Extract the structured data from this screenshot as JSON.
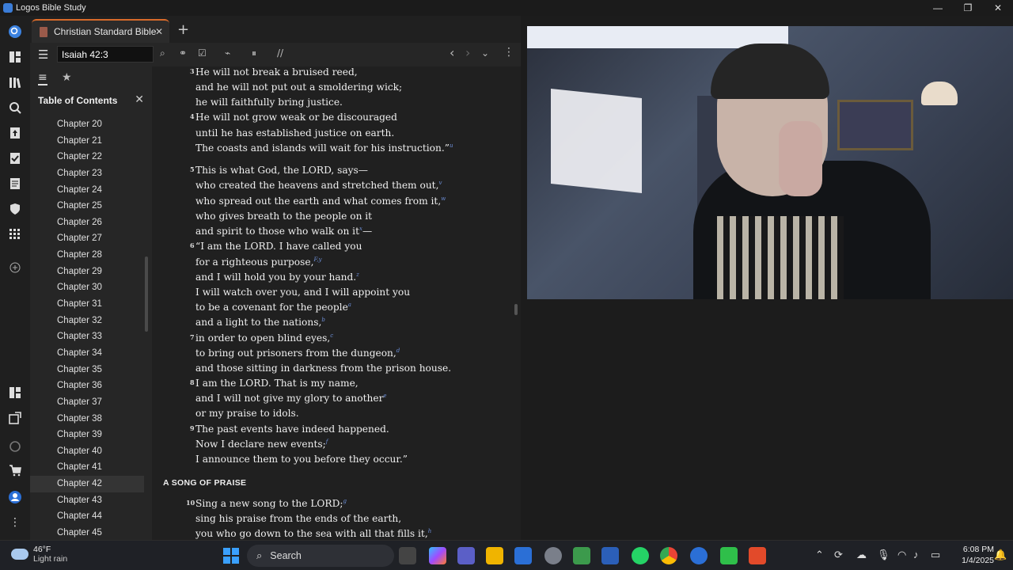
{
  "window": {
    "title": "Logos Bible Study",
    "minimize": "—",
    "restore": "❐",
    "close": "✕"
  },
  "tab": {
    "title": "Christian Standard Bible",
    "close": "✕",
    "new_tab": "+"
  },
  "toolbar": {
    "menu": "☰",
    "reference": "Isaiah 42:3",
    "search_icon": "⌕",
    "visual_filter_icon": "⚭",
    "highlight_icon": "☑",
    "inline_icon": "⌁",
    "layout_icon": "⏸",
    "parallel_icon": "//",
    "back": "‹",
    "forward": "›",
    "history": "⌄",
    "more": "⋮"
  },
  "sidebar": {
    "tab_contents_icon": "≡",
    "tab_favorites_icon": "★",
    "title": "Table of Contents",
    "close": "✕",
    "chapters": [
      "Chapter 20",
      "Chapter 21",
      "Chapter 22",
      "Chapter 23",
      "Chapter 24",
      "Chapter 25",
      "Chapter 26",
      "Chapter 27",
      "Chapter 28",
      "Chapter 29",
      "Chapter 30",
      "Chapter 31",
      "Chapter 32",
      "Chapter 33",
      "Chapter 34",
      "Chapter 35",
      "Chapter 36",
      "Chapter 37",
      "Chapter 38",
      "Chapter 39",
      "Chapter 40",
      "Chapter 41",
      "Chapter 42",
      "Chapter 43",
      "Chapter 44",
      "Chapter 45"
    ],
    "selected": "Chapter 42"
  },
  "reader": {
    "lines": [
      {
        "verse": "3",
        "text": "He will not break a bruised reed,",
        "fn": ""
      },
      {
        "verse": "",
        "text": "and he will not put out a smoldering wick;",
        "fn": ""
      },
      {
        "verse": "",
        "text": "he will faithfully bring justice.",
        "fn": ""
      },
      {
        "verse": "4",
        "text": "He will not grow weak or be discouraged",
        "fn": ""
      },
      {
        "verse": "",
        "text": "until he has established justice on earth.",
        "fn": ""
      },
      {
        "verse": "",
        "text": "The coasts and islands will wait for his instruction.”",
        "fn": "u"
      },
      {
        "verse": "5",
        "text": "This is what God, the LORD, says—",
        "fn": ""
      },
      {
        "verse": "",
        "text": "who created the heavens and stretched them out,",
        "fn": "v"
      },
      {
        "verse": "",
        "text": "who spread out the earth and what comes from it,",
        "fn": "w"
      },
      {
        "verse": "",
        "text": "who gives breath to the people on it",
        "fn": ""
      },
      {
        "verse": "",
        "text": "and spirit to those who walk on it",
        "fn": "x",
        "tail": "—"
      },
      {
        "verse": "6",
        "text": "“I am the LORD. I have called you",
        "fn": ""
      },
      {
        "verse": "",
        "text": "for a righteous purpose,",
        "fn": "F,y"
      },
      {
        "verse": "",
        "text": "and I will hold you by your hand.",
        "fn": "z"
      },
      {
        "verse": "",
        "text": "I will watch over you, and I will appoint you",
        "fn": ""
      },
      {
        "verse": "",
        "text": "to be a covenant for the people",
        "fn": "a"
      },
      {
        "verse": "",
        "text": "and a light to the nations,",
        "fn": "b"
      },
      {
        "verse": "7",
        "text": "in order to open blind eyes,",
        "fn": "c"
      },
      {
        "verse": "",
        "text": "to bring out prisoners from the dungeon,",
        "fn": "d"
      },
      {
        "verse": "",
        "text": "and those sitting in darkness from the prison house.",
        "fn": ""
      },
      {
        "verse": "8",
        "text": "I am the LORD. That is my name,",
        "fn": ""
      },
      {
        "verse": "",
        "text": "and I will not give my glory to another",
        "fn": "e"
      },
      {
        "verse": "",
        "text": "or my praise to idols.",
        "fn": ""
      },
      {
        "verse": "9",
        "text": "The past events have indeed happened.",
        "fn": ""
      },
      {
        "verse": "",
        "text": "Now I declare new events;",
        "fn": "f"
      },
      {
        "verse": "",
        "text": "I announce them to you before they occur.”",
        "fn": ""
      },
      {
        "verse": "10",
        "text": "Sing a new song to the LORD;",
        "fn": "g"
      },
      {
        "verse": "",
        "text": "sing his praise from the ends of the earth,",
        "fn": ""
      },
      {
        "verse": "",
        "text": "you who go down to the sea with all that fills it,",
        "fn": "h"
      }
    ],
    "heading": "A SONG OF PRAISE"
  },
  "taskbar": {
    "weather_temp": "46°F",
    "weather_desc": "Light rain",
    "search_placeholder": "Search",
    "time": "6:08 PM",
    "date": "1/4/2025"
  }
}
